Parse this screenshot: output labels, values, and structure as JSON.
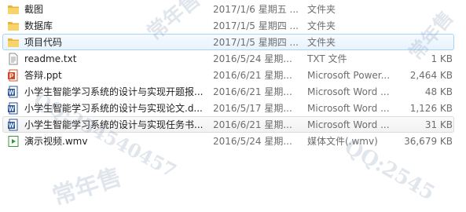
{
  "files": [
    {
      "name": "截图",
      "date": "2017/1/6 星期五 ...",
      "type": "文件夹",
      "size": "",
      "icon": "folder-icon"
    },
    {
      "name": "数据库",
      "date": "2017/1/5 星期四 ...",
      "type": "文件夹",
      "size": "",
      "icon": "folder-icon"
    },
    {
      "name": "项目代码",
      "date": "2017/1/5 星期四 ...",
      "type": "文件夹",
      "size": "",
      "icon": "folder-icon"
    },
    {
      "name": "readme.txt",
      "date": "2016/5/24 星期...",
      "type": "TXT 文件",
      "size": "1 KB",
      "icon": "txt-file-icon"
    },
    {
      "name": "答辩.ppt",
      "date": "2016/6/21 星期...",
      "type": "Microsoft Power...",
      "size": "2,464 KB",
      "icon": "powerpoint-file-icon"
    },
    {
      "name": "小学生智能学习系统的设计与实现开题报...",
      "date": "2016/6/21 星期...",
      "type": "Microsoft Word ...",
      "size": "48 KB",
      "icon": "word-file-icon"
    },
    {
      "name": "小学生智能学习系统的设计与实现论文.d...",
      "date": "2016/5/17 星期...",
      "type": "Microsoft Word ...",
      "size": "1,126 KB",
      "icon": "word-file-icon"
    },
    {
      "name": "小学生智能学习系统的设计与实现任务书...",
      "date": "2016/6/21 星期...",
      "type": "Microsoft Word ...",
      "size": "31 KB",
      "icon": "word-file-icon"
    },
    {
      "name": "演示视频.wmv",
      "date": "2016/5/24 星期...",
      "type": "媒体文件(.wmv)",
      "size": "36,679 KB",
      "icon": "video-file-icon"
    }
  ],
  "watermarks": [
    "常年售",
    "QQ:254540457",
    "常年售",
    "QQ:2545",
    "常年售"
  ]
}
